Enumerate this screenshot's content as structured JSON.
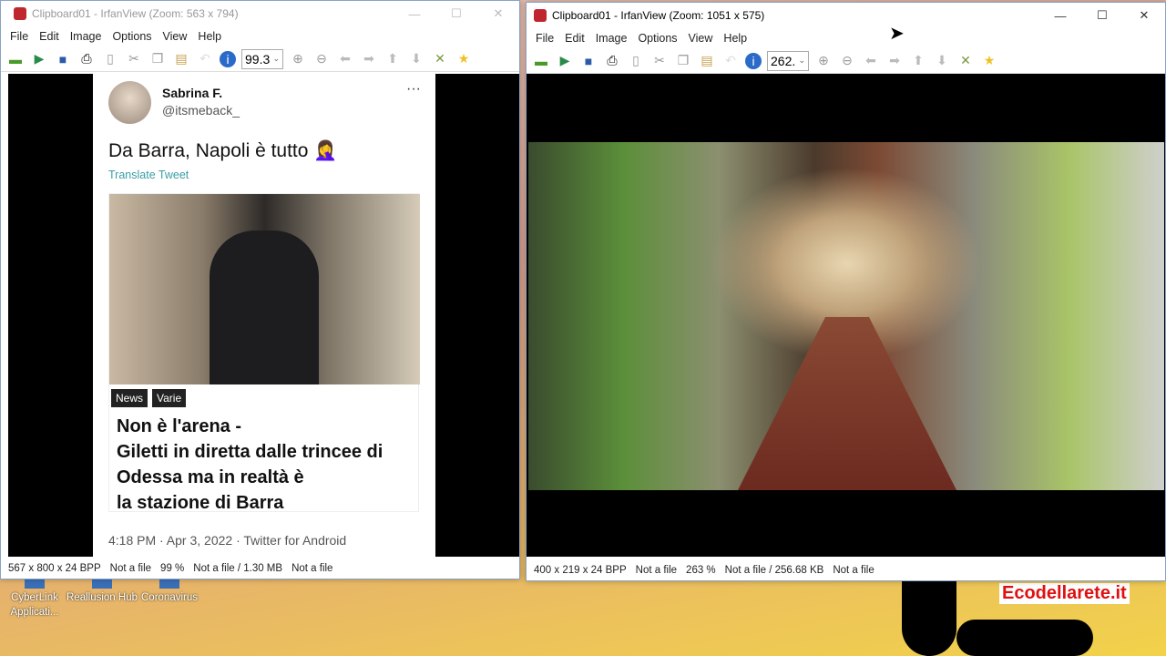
{
  "left_window": {
    "title": "Clipboard01 - IrfanView (Zoom: 563 x 794)",
    "menu": [
      "File",
      "Edit",
      "Image",
      "Options",
      "View",
      "Help"
    ],
    "zoom_value": "99.3",
    "status": [
      "567 x 800 x 24 BPP",
      "Not a file",
      "99 %",
      "Not a file / 1.30 MB",
      "Not a file"
    ],
    "tweet": {
      "name": "Sabrina F.",
      "handle": "@itsmeback_",
      "more": "···",
      "text": "Da Barra, Napoli è tutto 🤦‍♀️",
      "translate": "Translate Tweet",
      "tags": [
        "News",
        "Varie"
      ],
      "headline": "Non è l'arena -\nGiletti in diretta dalle trincee di\nOdessa ma in realtà è\nla stazione di Barra",
      "footer": "4:18 PM · Apr 3, 2022 · Twitter for Android"
    }
  },
  "right_window": {
    "title": "Clipboard01 - IrfanView (Zoom: 1051 x 575)",
    "menu": [
      "File",
      "Edit",
      "Image",
      "Options",
      "View",
      "Help"
    ],
    "zoom_value": "262.",
    "status": [
      "400 x 219 x 24 BPP",
      "Not a file",
      "263 %",
      "Not a file / 256.68 KB",
      "Not a file"
    ]
  },
  "desktop": {
    "icons": [
      {
        "label": "CyberLink Applicati..."
      },
      {
        "label": "Reallusion Hub"
      },
      {
        "label": "Coronavirus"
      }
    ],
    "watermark": "Ecodellarete.it"
  },
  "window_controls": {
    "minimize": "—",
    "maximize": "☐",
    "close": "✕"
  }
}
